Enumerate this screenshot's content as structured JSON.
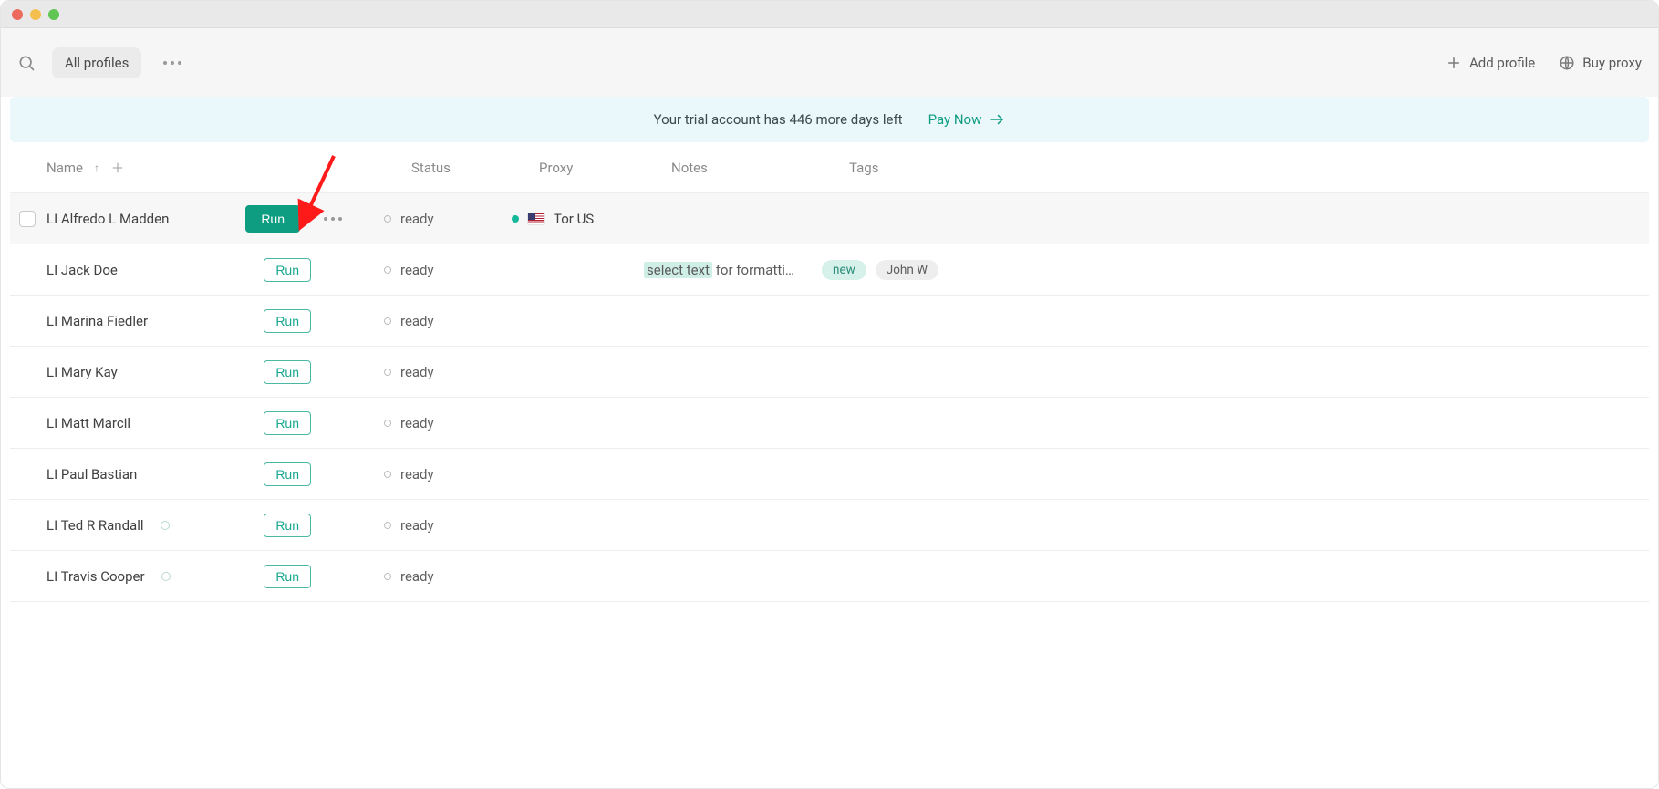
{
  "toolbar": {
    "filter_label": "All profiles",
    "add_profile_label": "Add profile",
    "buy_proxy_label": "Buy proxy"
  },
  "banner": {
    "text": "Your trial account has 446 more days left",
    "cta": "Pay Now"
  },
  "columns": {
    "name": "Name",
    "status": "Status",
    "proxy": "Proxy",
    "notes": "Notes",
    "tags": "Tags"
  },
  "run_label": "Run",
  "rows": [
    {
      "name": "LI Alfredo L Madden",
      "status": "ready",
      "proxy": "Tor US",
      "proxy_hasflag": true,
      "proxy_online": true,
      "notes_highlight": "",
      "notes_rest": "",
      "tags": [],
      "hovered": true,
      "name_indicator": false
    },
    {
      "name": "LI Jack Doe",
      "status": "ready",
      "proxy": "",
      "proxy_hasflag": false,
      "proxy_online": false,
      "notes_highlight": "select text",
      "notes_rest": " for formatti…",
      "tags": [
        {
          "text": "new",
          "cls": "tag-new"
        },
        {
          "text": "John W",
          "cls": "tag-gray"
        }
      ],
      "hovered": false,
      "name_indicator": false
    },
    {
      "name": "LI Marina Fiedler",
      "status": "ready",
      "proxy": "",
      "proxy_hasflag": false,
      "proxy_online": false,
      "notes_highlight": "",
      "notes_rest": "",
      "tags": [],
      "hovered": false,
      "name_indicator": false
    },
    {
      "name": "LI Mary Kay",
      "status": "ready",
      "proxy": "",
      "proxy_hasflag": false,
      "proxy_online": false,
      "notes_highlight": "",
      "notes_rest": "",
      "tags": [],
      "hovered": false,
      "name_indicator": false
    },
    {
      "name": "LI Matt Marcil",
      "status": "ready",
      "proxy": "",
      "proxy_hasflag": false,
      "proxy_online": false,
      "notes_highlight": "",
      "notes_rest": "",
      "tags": [],
      "hovered": false,
      "name_indicator": false
    },
    {
      "name": "LI Paul Bastian",
      "status": "ready",
      "proxy": "",
      "proxy_hasflag": false,
      "proxy_online": false,
      "notes_highlight": "",
      "notes_rest": "",
      "tags": [],
      "hovered": false,
      "name_indicator": false
    },
    {
      "name": "LI Ted R Randall",
      "status": "ready",
      "proxy": "",
      "proxy_hasflag": false,
      "proxy_online": false,
      "notes_highlight": "",
      "notes_rest": "",
      "tags": [],
      "hovered": false,
      "name_indicator": true
    },
    {
      "name": "LI Travis Cooper",
      "status": "ready",
      "proxy": "",
      "proxy_hasflag": false,
      "proxy_online": false,
      "notes_highlight": "",
      "notes_rest": "",
      "tags": [],
      "hovered": false,
      "name_indicator": true
    }
  ]
}
